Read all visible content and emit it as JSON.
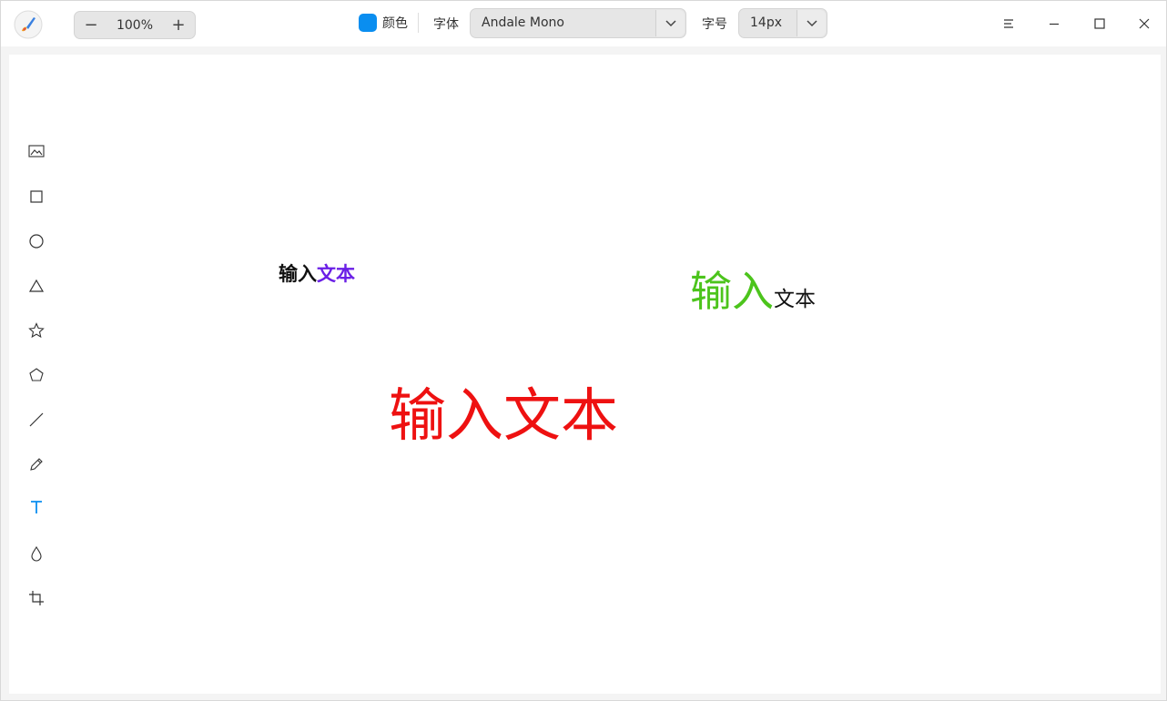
{
  "toolbar": {
    "zoom": {
      "minus_label": "−",
      "value": "100%",
      "plus_label": "+"
    },
    "color": {
      "label": "颜色",
      "value": "#0a8ef0"
    },
    "font": {
      "label": "字体",
      "value": "Andale Mono"
    },
    "font_size": {
      "label": "字号",
      "value": "14px"
    }
  },
  "window_controls": [
    "menu-icon",
    "minimize-icon",
    "maximize-icon",
    "close-icon"
  ],
  "tools": [
    {
      "name": "image-tool",
      "icon": "image-icon"
    },
    {
      "name": "rectangle-tool",
      "icon": "rectangle-icon"
    },
    {
      "name": "ellipse-tool",
      "icon": "ellipse-icon"
    },
    {
      "name": "triangle-tool",
      "icon": "triangle-icon"
    },
    {
      "name": "star-tool",
      "icon": "star-icon"
    },
    {
      "name": "polygon-tool",
      "icon": "pentagon-icon"
    },
    {
      "name": "line-tool",
      "icon": "line-icon"
    },
    {
      "name": "pen-tool",
      "icon": "pen-icon"
    },
    {
      "name": "text-tool",
      "icon": "text-icon",
      "active": true
    },
    {
      "name": "blur-tool",
      "icon": "drop-icon"
    },
    {
      "name": "crop-tool",
      "icon": "crop-icon"
    }
  ],
  "canvas_texts": [
    {
      "id": "text-1",
      "parts": [
        {
          "text": "输入",
          "color": "#111111"
        },
        {
          "text": "文本",
          "color": "#6a1fe6"
        }
      ]
    },
    {
      "id": "text-2",
      "parts": [
        {
          "text": "输入",
          "color": "#4cc41c"
        },
        {
          "text": "文本",
          "color": "#111111"
        }
      ]
    },
    {
      "id": "text-3",
      "parts": [
        {
          "text": "输入文本",
          "color": "#ee1111"
        }
      ]
    }
  ],
  "colors": {
    "accent": "#0a8ef0",
    "active_tool": "#0a8ef0"
  }
}
